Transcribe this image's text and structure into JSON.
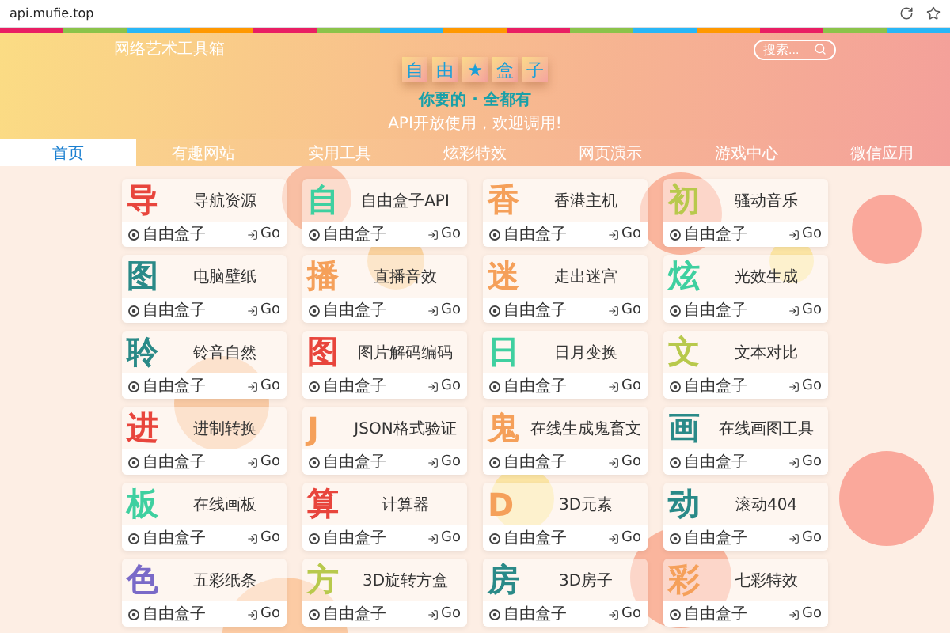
{
  "browser": {
    "address": "api.mufie.top"
  },
  "header": {
    "site_title": "网络艺术工具箱",
    "search": {
      "placeholder": "搜索..."
    },
    "logo": [
      "自",
      "由",
      "★",
      "盒",
      "子"
    ],
    "tagline": "你要的 · 全都有",
    "subtitle": "API开放使用，欢迎调用!"
  },
  "nav": [
    {
      "label": "首页",
      "selected": true
    },
    {
      "label": "有趣网站",
      "selected": false
    },
    {
      "label": "实用工具",
      "selected": false
    },
    {
      "label": "炫彩特效",
      "selected": false
    },
    {
      "label": "网页演示",
      "selected": false
    },
    {
      "label": "游戏中心",
      "selected": false
    },
    {
      "label": "微信应用",
      "selected": false
    }
  ],
  "cards": [
    {
      "glyph": "导",
      "color": "#e8453c",
      "title": "导航资源",
      "author": "自由盒子",
      "action": "Go"
    },
    {
      "glyph": "自",
      "color": "#3fd0a0",
      "title": "自由盒子API",
      "author": "自由盒子",
      "action": "Go"
    },
    {
      "glyph": "香",
      "color": "#f5a05a",
      "title": "香港主机",
      "author": "自由盒子",
      "action": "Go"
    },
    {
      "glyph": "初",
      "color": "#b8c94c",
      "title": "骚动音乐",
      "author": "自由盒子",
      "action": "Go"
    },
    {
      "glyph": "图",
      "color": "#2a8a88",
      "title": "电脑壁纸",
      "author": "自由盒子",
      "action": "Go"
    },
    {
      "glyph": "播",
      "color": "#f5a05a",
      "title": "直播音效",
      "author": "自由盒子",
      "action": "Go"
    },
    {
      "glyph": "迷",
      "color": "#f5a05a",
      "title": "走出迷宫",
      "author": "自由盒子",
      "action": "Go"
    },
    {
      "glyph": "炫",
      "color": "#3fd0a0",
      "title": "光效生成",
      "author": "自由盒子",
      "action": "Go"
    },
    {
      "glyph": "聆",
      "color": "#2a8a88",
      "title": "铃音自然",
      "author": "自由盒子",
      "action": "Go"
    },
    {
      "glyph": "图",
      "color": "#e8453c",
      "title": "图片解码编码",
      "author": "自由盒子",
      "action": "Go"
    },
    {
      "glyph": "日",
      "color": "#3fd0a0",
      "title": "日月变换",
      "author": "自由盒子",
      "action": "Go"
    },
    {
      "glyph": "文",
      "color": "#b8c94c",
      "title": "文本对比",
      "author": "自由盒子",
      "action": "Go"
    },
    {
      "glyph": "进",
      "color": "#e8453c",
      "title": "进制转换",
      "author": "自由盒子",
      "action": "Go"
    },
    {
      "glyph": "J",
      "color": "#f5a05a",
      "title": "JSON格式验证",
      "author": "自由盒子",
      "action": "Go"
    },
    {
      "glyph": "鬼",
      "color": "#f5a05a",
      "title": "在线生成鬼畜文",
      "author": "自由盒子",
      "action": "Go"
    },
    {
      "glyph": "画",
      "color": "#2a8a88",
      "title": "在线画图工具",
      "author": "自由盒子",
      "action": "Go"
    },
    {
      "glyph": "板",
      "color": "#3fd0a0",
      "title": "在线画板",
      "author": "自由盒子",
      "action": "Go"
    },
    {
      "glyph": "算",
      "color": "#e8453c",
      "title": "计算器",
      "author": "自由盒子",
      "action": "Go"
    },
    {
      "glyph": "D",
      "color": "#f5a05a",
      "title": "3D元素",
      "author": "自由盒子",
      "action": "Go"
    },
    {
      "glyph": "动",
      "color": "#2a8a88",
      "title": "滚动404",
      "author": "自由盒子",
      "action": "Go"
    },
    {
      "glyph": "色",
      "color": "#7a6ac8",
      "title": "五彩纸条",
      "author": "自由盒子",
      "action": "Go"
    },
    {
      "glyph": "方",
      "color": "#b8c94c",
      "title": "3D旋转方盒",
      "author": "自由盒子",
      "action": "Go"
    },
    {
      "glyph": "房",
      "color": "#2a8a88",
      "title": "3D房子",
      "author": "自由盒子",
      "action": "Go"
    },
    {
      "glyph": "彩",
      "color": "#f5a05a",
      "title": "七彩特效",
      "author": "自由盒子",
      "action": "Go"
    }
  ]
}
